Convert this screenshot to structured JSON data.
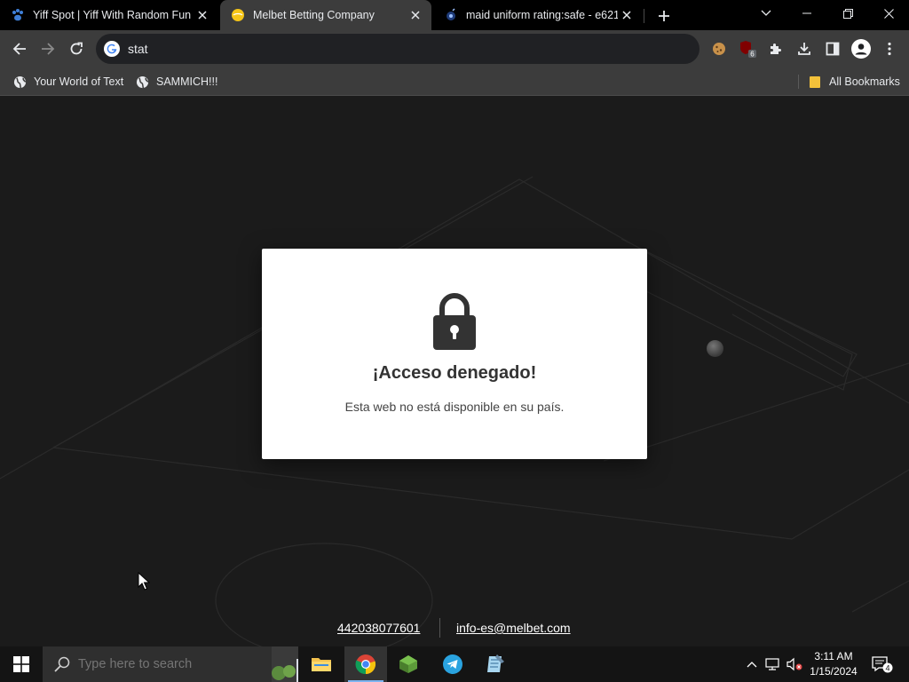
{
  "tabs": [
    {
      "title": "Yiff Spot | Yiff With Random Fun",
      "favicon": "paw-icon"
    },
    {
      "title": "Melbet Betting Company",
      "favicon": "melbet-ball-icon",
      "active": true
    },
    {
      "title": "maid uniform rating:safe - e621",
      "favicon": "e621-icon"
    }
  ],
  "toolbar": {
    "address_value": "stat",
    "extension_badge": "6"
  },
  "bookmarks": {
    "items": [
      {
        "label": "Your World of Text",
        "icon": "globe-icon"
      },
      {
        "label": "SAMMICH!!!",
        "icon": "globe-icon"
      }
    ],
    "all_bookmarks": "All Bookmarks"
  },
  "page": {
    "heading": "¡Acceso denegado!",
    "message": "Esta web no está disponible en su país.",
    "phone": "442038077601",
    "email": "info-es@melbet.com"
  },
  "taskbar": {
    "search_placeholder": "Type here to search",
    "time": "3:11 AM",
    "date": "1/15/2024",
    "notification_count": "4"
  },
  "colors": {
    "tabstrip": "#000000",
    "toolbar": "#3c3c3c",
    "page_bg": "#1b1b1b",
    "modal_bg": "#ffffff",
    "taskbar": "#141414"
  }
}
